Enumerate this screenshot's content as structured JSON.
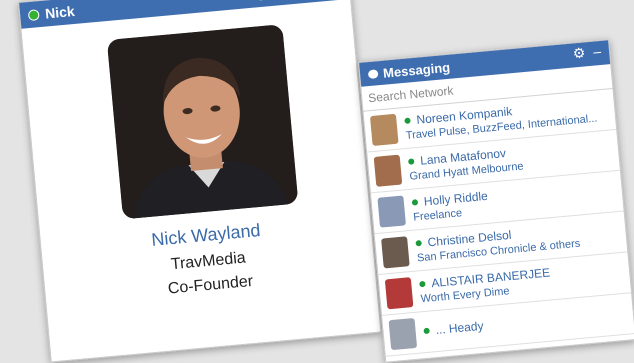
{
  "chat_window": {
    "name": "Nick",
    "icons": [
      "paperclip-icon",
      "gear-icon",
      "expand-icon",
      "minimize-icon",
      "close-icon"
    ],
    "profile": {
      "name": "Nick Wayland",
      "company": "TravMedia",
      "title": "Co-Founder"
    }
  },
  "messaging": {
    "title": "Messaging",
    "search_placeholder": "Search Network",
    "contacts": [
      {
        "name": "Noreen Kompanik",
        "subtitle": "Travel Pulse, BuzzFeed, International...",
        "avatar_color": "#b68a5f"
      },
      {
        "name": "Lana Matafonov",
        "subtitle": "Grand Hyatt Melbourne",
        "avatar_color": "#a26d4c"
      },
      {
        "name": "Holly Riddle",
        "subtitle": "Freelance",
        "avatar_color": "#8a9ab6"
      },
      {
        "name": "Christine Delsol",
        "subtitle": "San Francisco Chronicle & others",
        "avatar_color": "#6b5a4e"
      },
      {
        "name": "ALISTAIR BANERJEE",
        "subtitle": "Worth Every Dime",
        "avatar_color": "#b43a3a"
      },
      {
        "name": "... Heady",
        "subtitle": "",
        "avatar_color": "#9aa2b0"
      }
    ]
  }
}
